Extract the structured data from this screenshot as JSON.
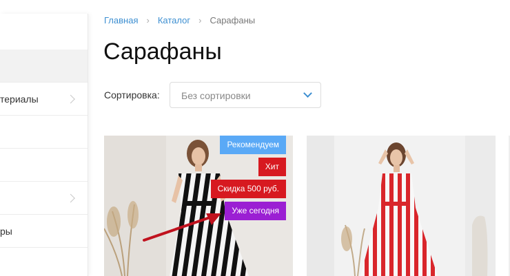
{
  "sidebar": {
    "items": [
      {
        "label": ""
      },
      {
        "label": ""
      },
      {
        "label": "териалы"
      },
      {
        "label": ""
      },
      {
        "label": ""
      },
      {
        "label": ""
      },
      {
        "label": "ры"
      },
      {
        "label": ""
      }
    ]
  },
  "breadcrumb": {
    "home": "Главная",
    "catalog": "Каталог",
    "current": "Сарафаны"
  },
  "page": {
    "title": "Сарафаны"
  },
  "sort": {
    "label": "Сортировка:",
    "value": "Без сортировки"
  },
  "products": [
    {
      "badges": [
        {
          "text": "Рекомендуем",
          "color": "#5aa9f6"
        },
        {
          "text": "Хит",
          "color": "#d71920"
        },
        {
          "text": "Скидка 500 руб.",
          "color": "#d71920"
        },
        {
          "text": "Уже сегодня",
          "color": "#9b1fd3"
        }
      ]
    },
    {
      "badges": []
    }
  ],
  "colors": {
    "link": "#3d8fd1",
    "arrow": "#c0121e"
  }
}
